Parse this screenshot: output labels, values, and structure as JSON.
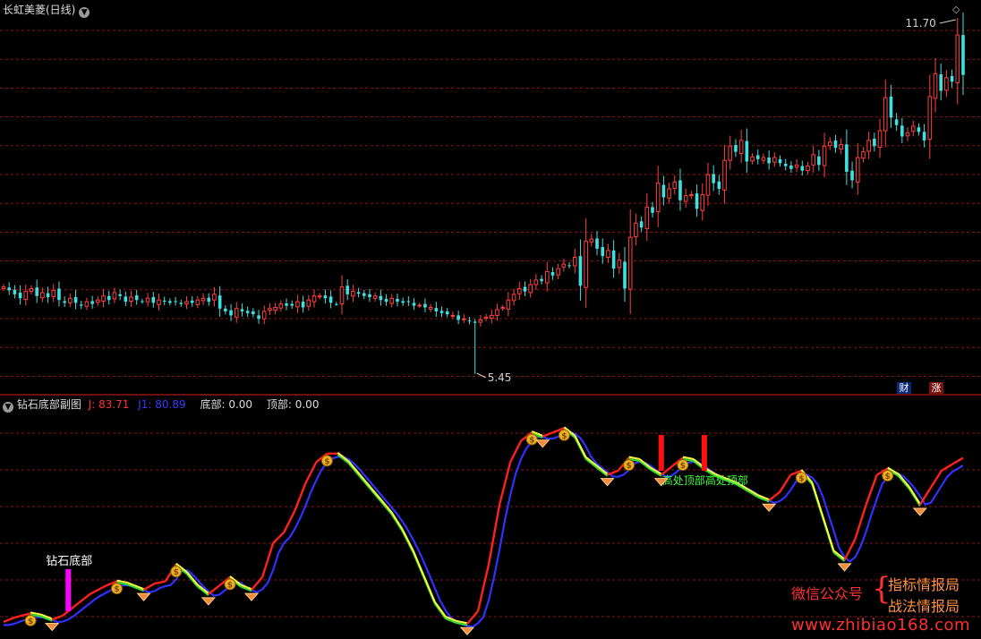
{
  "header": {
    "title": "长虹美菱(日线)",
    "sub_title": "钻石底部副图",
    "j_label": "J: 83.71",
    "j1_label": "J1: 80.89",
    "bottom_label": "底部: 0.00",
    "top_label": "顶部: 0.00"
  },
  "badges": {
    "cai": "财",
    "zhang": "涨"
  },
  "colors": {
    "up": "#ff4040",
    "down": "#40e0e0",
    "grid": "#8a1414",
    "divider": "#b01818",
    "j_line": "#ff2020",
    "j1_line": "#3030ff",
    "sell_line": "#ffff40",
    "buy_line": "#30e030",
    "diamond_bar": "#ff00ff",
    "top_bar": "#ff1010",
    "annot_text": "#40ff40",
    "watermark_red": "#ff3030",
    "watermark_orange": "#ff9040"
  },
  "watermark": {
    "wechat": "微信公众号",
    "brace": "{",
    "line1": "指标情报局",
    "line2": "战法情报局",
    "url": "www.zhibiao168.com"
  },
  "chart_data": [
    {
      "type": "candlestick",
      "title": "长虹美菱(日线)",
      "price_max_label": "11.70",
      "price_min_label": "5.45",
      "max_price": 11.7,
      "min_price": 5.45,
      "note": "approximate daily closes read from the chart",
      "closes": [
        6.98,
        6.92,
        6.85,
        6.78,
        6.9,
        6.95,
        6.82,
        6.88,
        6.8,
        6.92,
        6.75,
        6.7,
        6.78,
        6.7,
        6.65,
        6.72,
        6.68,
        6.75,
        6.82,
        6.75,
        6.88,
        6.82,
        6.72,
        6.8,
        6.75,
        6.72,
        6.78,
        6.7,
        6.75,
        6.72,
        6.7,
        6.72,
        6.68,
        6.72,
        6.7,
        6.75,
        6.78,
        6.72,
        6.85,
        6.6,
        6.55,
        6.48,
        6.6,
        6.55,
        6.52,
        6.5,
        6.42,
        6.55,
        6.6,
        6.62,
        6.68,
        6.65,
        6.65,
        6.72,
        6.62,
        6.75,
        6.82,
        6.82,
        6.78,
        6.7,
        6.68,
        6.98,
        6.85,
        6.9,
        6.86,
        6.82,
        6.8,
        6.82,
        6.75,
        6.72,
        6.78,
        6.72,
        6.7,
        6.72,
        6.65,
        6.66,
        6.62,
        6.62,
        6.55,
        6.52,
        6.5,
        6.48,
        6.4,
        6.42,
        6.38,
        6.35,
        6.4,
        6.45,
        6.48,
        6.58,
        6.62,
        6.75,
        6.85,
        6.95,
        6.9,
        7.02,
        7.1,
        7.08,
        7.25,
        7.18,
        7.3,
        7.38,
        7.35,
        7.5,
        7.0,
        7.78,
        7.82,
        7.65,
        7.52,
        7.62,
        7.3,
        7.45,
        6.95,
        7.85,
        8.1,
        8.02,
        8.38,
        8.28,
        8.8,
        8.55,
        8.7,
        8.82,
        8.5,
        8.58,
        8.6,
        8.35,
        8.6,
        8.95,
        8.8,
        8.7,
        9.2,
        9.45,
        9.35,
        9.55,
        9.18,
        9.26,
        9.22,
        9.25,
        9.15,
        9.25,
        9.15,
        9.1,
        9.05,
        9.12,
        9.02,
        9.1,
        9.3,
        9.12,
        9.45,
        9.52,
        9.42,
        9.48,
        9.0,
        8.85,
        9.25,
        9.35,
        9.55,
        9.45,
        9.72,
        10.3,
        9.95,
        9.82,
        9.62,
        9.68,
        9.8,
        9.7,
        9.55,
        10.32,
        10.72,
        10.42,
        10.65,
        10.58,
        11.4,
        10.7
      ]
    },
    {
      "type": "line",
      "title": "钻石底部副图",
      "series": [
        {
          "name": "J",
          "last_value": 83.71
        },
        {
          "name": "J1",
          "last_value": 80.89
        },
        {
          "name": "底部",
          "last_value": 0.0
        },
        {
          "name": "顶部",
          "last_value": 0.0
        }
      ],
      "note": "approximate oscillator shape on 0-100 scale",
      "j_series": [
        [
          0,
          3
        ],
        [
          2,
          5
        ],
        [
          5,
          7
        ],
        [
          7,
          6
        ],
        [
          9,
          4
        ],
        [
          11,
          6
        ],
        [
          14,
          12
        ],
        [
          16,
          16
        ],
        [
          19,
          20
        ],
        [
          21,
          22
        ],
        [
          23,
          21
        ],
        [
          26,
          18
        ],
        [
          28,
          21
        ],
        [
          30,
          22
        ],
        [
          32,
          30
        ],
        [
          34,
          26
        ],
        [
          36,
          20
        ],
        [
          38,
          16
        ],
        [
          40,
          20
        ],
        [
          42,
          24
        ],
        [
          44,
          20
        ],
        [
          46,
          18
        ],
        [
          48,
          24
        ],
        [
          50,
          40
        ],
        [
          52,
          45
        ],
        [
          54,
          55
        ],
        [
          56,
          68
        ],
        [
          58,
          78
        ],
        [
          60,
          82
        ],
        [
          62,
          82
        ],
        [
          64,
          78
        ],
        [
          66,
          72
        ],
        [
          68,
          66
        ],
        [
          70,
          60
        ],
        [
          72,
          54
        ],
        [
          74,
          46
        ],
        [
          76,
          36
        ],
        [
          78,
          24
        ],
        [
          80,
          12
        ],
        [
          82,
          5
        ],
        [
          84,
          3
        ],
        [
          86,
          2
        ],
        [
          88,
          8
        ],
        [
          90,
          30
        ],
        [
          92,
          58
        ],
        [
          94,
          78
        ],
        [
          96,
          88
        ],
        [
          98,
          92
        ],
        [
          100,
          90
        ],
        [
          102,
          92
        ],
        [
          104,
          94
        ],
        [
          106,
          90
        ],
        [
          108,
          80
        ],
        [
          110,
          76
        ],
        [
          112,
          72
        ],
        [
          114,
          74
        ],
        [
          116,
          80
        ],
        [
          118,
          79
        ],
        [
          120,
          75
        ],
        [
          122,
          72
        ],
        [
          124,
          76
        ],
        [
          126,
          80
        ],
        [
          128,
          79
        ],
        [
          130,
          75
        ],
        [
          132,
          72
        ],
        [
          134,
          70
        ],
        [
          136,
          68
        ],
        [
          138,
          65
        ],
        [
          140,
          62
        ],
        [
          142,
          60
        ],
        [
          144,
          64
        ],
        [
          146,
          72
        ],
        [
          148,
          74
        ],
        [
          150,
          68
        ],
        [
          152,
          52
        ],
        [
          154,
          36
        ],
        [
          156,
          32
        ],
        [
          158,
          42
        ],
        [
          160,
          58
        ],
        [
          162,
          72
        ],
        [
          164,
          75
        ],
        [
          166,
          72
        ],
        [
          168,
          66
        ],
        [
          170,
          58
        ],
        [
          172,
          66
        ],
        [
          174,
          74
        ],
        [
          176,
          77
        ],
        [
          178,
          80
        ]
      ],
      "signals": {
        "diamond_bottom_index": 12,
        "diamond_bottom_label": "钻石底部",
        "high_top_indices": [
          122,
          130
        ],
        "high_top_label": "高处顶部"
      }
    }
  ]
}
